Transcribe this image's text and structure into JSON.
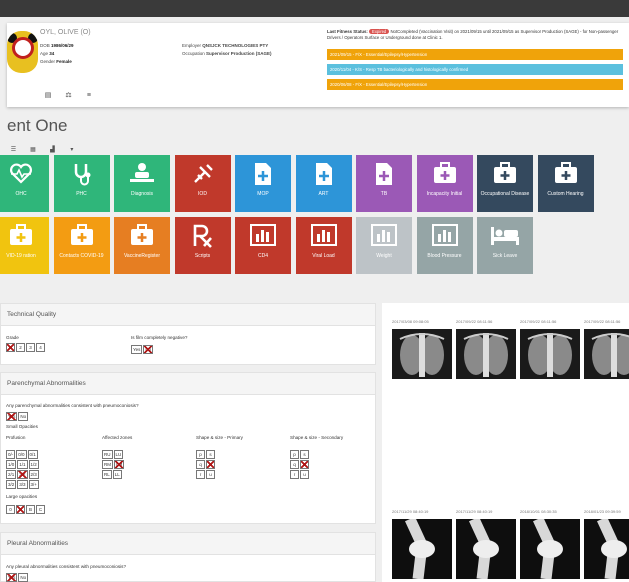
{
  "patient": {
    "name": "OYL, OLIVE (O)",
    "dob_label": "DOB",
    "dob": "1986/06/29",
    "age_label": "Age",
    "age": "34",
    "gender_label": "Gender",
    "gender": "Female",
    "employer_label": "Employer",
    "employer": "QNSJCK TECHNOLOGIES PTY",
    "occupation_label": "Occupation",
    "occupation": "Supervisor Production (SAGE)"
  },
  "fitness": {
    "label": "Last Fitness Status:",
    "badge": "Expired",
    "text": "NotCompleted (Vaccination Visit) on 2021/09/15 until 2021/09/15 as Supervisor Production (SAGE) - for Non-passenger Drivers / Operators Surface or Underground done at Clinic 1."
  },
  "alerts": [
    {
      "text": "2021/09/15 - F/X - Essential/Epilepsy/Hypertension",
      "color": "#f0a30a"
    },
    {
      "text": "2020/11/04 - K/S - Resp TB bacteriologically and histologically confirmed",
      "color": "#5bc0de"
    },
    {
      "text": "2020/06/08 - F/X - Essential/Epilepsy/Hypertension",
      "color": "#f0a30a"
    }
  ],
  "header_icons": [
    "id-card-icon",
    "weight-icon",
    "list-icon"
  ],
  "section_title": "ent One",
  "toolbar": [
    "list-icon",
    "grid-icon",
    "chart-icon",
    "dropdown-icon"
  ],
  "tiles_row1": [
    {
      "label": "OHC",
      "color": "#2fb67a",
      "icon": "heart"
    },
    {
      "label": "PHC",
      "color": "#2fb67a",
      "icon": "stethoscope"
    },
    {
      "label": "Diagnosis",
      "color": "#2fb67a",
      "icon": "doctor"
    },
    {
      "label": "IOD",
      "color": "#c0392b",
      "icon": "syringe"
    },
    {
      "label": "MOP",
      "color": "#2d95d8",
      "icon": "file-plus"
    },
    {
      "label": "ART",
      "color": "#2d95d8",
      "icon": "file-plus"
    },
    {
      "label": "TB",
      "color": "#9b59b6",
      "icon": "file-plus"
    },
    {
      "label": "Incapacity Initial",
      "color": "#9b59b6",
      "icon": "case"
    },
    {
      "label": "Occupational Disease",
      "color": "#34495e",
      "icon": "case"
    },
    {
      "label": "Custom Hearing",
      "color": "#34495e",
      "icon": "case"
    }
  ],
  "tiles_row2": [
    {
      "label": "VID-19 ration",
      "color": "#f1c40f",
      "icon": "case"
    },
    {
      "label": "Contacts COVID-19",
      "color": "#f39c12",
      "icon": "case"
    },
    {
      "label": "VaccineRegister",
      "color": "#e67e22",
      "icon": "case"
    },
    {
      "label": "Scripts",
      "color": "#c0392b",
      "icon": "rx"
    },
    {
      "label": "CD4",
      "color": "#c0392b",
      "icon": "bars"
    },
    {
      "label": "Viral Load",
      "color": "#c0392b",
      "icon": "bars"
    },
    {
      "label": "Weight",
      "color": "#bdc3c7",
      "icon": "bars"
    },
    {
      "label": "Blood Pressure",
      "color": "#95a5a6",
      "icon": "bars"
    },
    {
      "label": "Sick Leave",
      "color": "#95a5a6",
      "icon": "bed"
    }
  ],
  "technical": {
    "title": "Technical Quality",
    "grade_label": "Grade",
    "grade_options": [
      "1",
      "2",
      "3",
      "4"
    ],
    "negative_label": "Is film completely negative?",
    "negative_options": [
      "Yes",
      "No"
    ]
  },
  "parenchymal": {
    "title": "Parenchymal Abnormalities",
    "question": "Any parenchymal abnormalities consistent with pneumoconiosis?",
    "yes_no": [
      "Yes",
      "No"
    ],
    "small_opacities": "Small Opacities",
    "profusion_label": "Profusion",
    "profusion_rows": [
      [
        "0/-",
        "0/0",
        "0/1"
      ],
      [
        "1/0",
        "1/1",
        "1/2"
      ],
      [
        "2/1",
        "2/2",
        "2/3"
      ],
      [
        "3/2",
        "3/3",
        "3/+"
      ]
    ],
    "zones_label": "Affected zones",
    "zones_rows": [
      [
        "RU",
        "LU"
      ],
      [
        "RM",
        "LM"
      ],
      [
        "RL",
        "LL"
      ]
    ],
    "primary_label": "Shape & size - Primary",
    "primary_rows": [
      [
        "p",
        "s"
      ],
      [
        "q",
        "t"
      ],
      [
        "r",
        "u"
      ]
    ],
    "secondary_label": "Shape & size - Secondary",
    "secondary_rows": [
      [
        "p",
        "s"
      ],
      [
        "q",
        "t"
      ],
      [
        "r",
        "u"
      ]
    ],
    "large_label": "Large opacities",
    "large_options": [
      "0",
      "A",
      "B",
      "C"
    ]
  },
  "pleural": {
    "title": "Pleural Abnormalities",
    "question": "Any pleural abnormalities consistent with pneumoconiosis?",
    "yes_no": [
      "Yes",
      "No"
    ]
  },
  "xray_dates_top": [
    "2017/03/08 09:08:05",
    "2017/09/22 08:11:56",
    "2017/09/22 08:11:56",
    "2017/09/22 08:11:56"
  ],
  "xray_dates_bottom": [
    "2017/11/29 08:40:19",
    "2017/11/29 08:40:19",
    "2018/10/01 08:30:35",
    "2018/01/23 09:39:59"
  ]
}
